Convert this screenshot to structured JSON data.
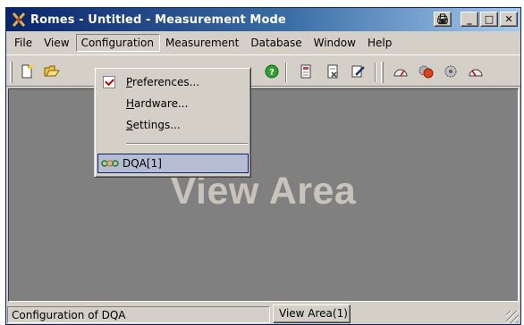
{
  "window": {
    "title": "Romes - Untitled - Measurement Mode",
    "controls": {
      "extra": "🖨",
      "minimize": "_",
      "maximize": "□",
      "close": "✕"
    }
  },
  "menubar": {
    "items": [
      "File",
      "View",
      "Configuration",
      "Measurement",
      "Database",
      "Window",
      "Help"
    ],
    "active": "Configuration"
  },
  "toolbar": {
    "icons": [
      "new-document-icon",
      "open-folder-icon",
      "help-icon",
      "document-icon",
      "document-icon",
      "edit-icon",
      "gauge-icon",
      "gear-red-icon",
      "gear-icon",
      "gauge-icon"
    ]
  },
  "dropdown": {
    "items": [
      {
        "pre": "",
        "u": "P",
        "post": "references...",
        "icon": "checkbox-icon"
      },
      {
        "pre": "",
        "u": "H",
        "post": "ardware...",
        "icon": ""
      },
      {
        "pre": "",
        "u": "S",
        "post": "ettings...",
        "icon": ""
      },
      {
        "pre": "DQA[1]",
        "u": "",
        "post": "",
        "icon": "dqa-icon"
      }
    ]
  },
  "view": {
    "label": "View Area"
  },
  "statusbar": {
    "message": "Configuration of DQA",
    "tab": "View Area(1)"
  },
  "colors": {
    "titlebar_start": "#0a246a",
    "titlebar_end": "#a6caf0",
    "view_bg": "#808080",
    "face": "#d4d0c8"
  }
}
